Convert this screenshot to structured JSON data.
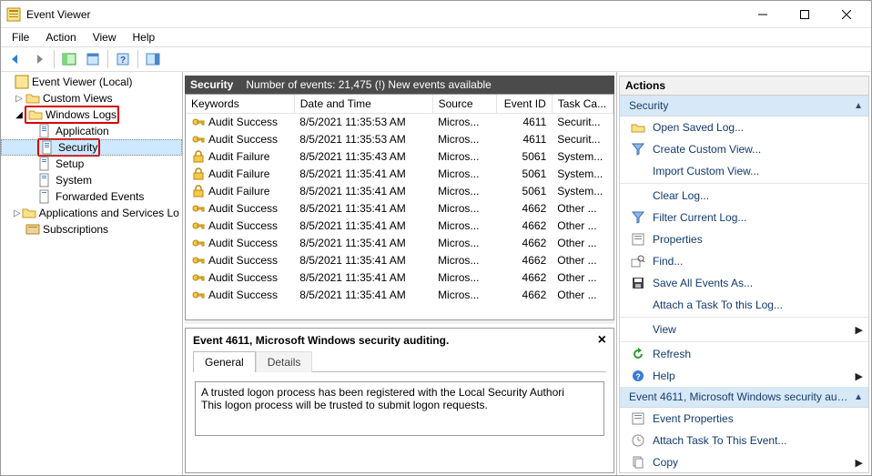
{
  "window": {
    "title": "Event Viewer"
  },
  "menu": {
    "file": "File",
    "action": "Action",
    "view": "View",
    "help": "Help"
  },
  "tree": {
    "root": "Event Viewer (Local)",
    "custom_views": "Custom Views",
    "windows_logs": "Windows Logs",
    "application": "Application",
    "security": "Security",
    "setup": "Setup",
    "system": "System",
    "forwarded": "Forwarded Events",
    "apps_services": "Applications and Services Lo",
    "subscriptions": "Subscriptions"
  },
  "gridHeader": {
    "title": "Security",
    "count_label": "Number of events: 21,475 (!) New events available"
  },
  "columns": {
    "keywords": "Keywords",
    "datetime": "Date and Time",
    "source": "Source",
    "eventid": "Event ID",
    "taskcat": "Task Ca..."
  },
  "events": [
    {
      "icon": "key",
      "keywords": "Audit Success",
      "dt": "8/5/2021 11:35:53 AM",
      "source": "Micros...",
      "id": "4611",
      "cat": "Securit..."
    },
    {
      "icon": "key",
      "keywords": "Audit Success",
      "dt": "8/5/2021 11:35:53 AM",
      "source": "Micros...",
      "id": "4611",
      "cat": "Securit..."
    },
    {
      "icon": "lock",
      "keywords": "Audit Failure",
      "dt": "8/5/2021 11:35:43 AM",
      "source": "Micros...",
      "id": "5061",
      "cat": "System..."
    },
    {
      "icon": "lock",
      "keywords": "Audit Failure",
      "dt": "8/5/2021 11:35:41 AM",
      "source": "Micros...",
      "id": "5061",
      "cat": "System..."
    },
    {
      "icon": "lock",
      "keywords": "Audit Failure",
      "dt": "8/5/2021 11:35:41 AM",
      "source": "Micros...",
      "id": "5061",
      "cat": "System..."
    },
    {
      "icon": "key",
      "keywords": "Audit Success",
      "dt": "8/5/2021 11:35:41 AM",
      "source": "Micros...",
      "id": "4662",
      "cat": "Other ..."
    },
    {
      "icon": "key",
      "keywords": "Audit Success",
      "dt": "8/5/2021 11:35:41 AM",
      "source": "Micros...",
      "id": "4662",
      "cat": "Other ..."
    },
    {
      "icon": "key",
      "keywords": "Audit Success",
      "dt": "8/5/2021 11:35:41 AM",
      "source": "Micros...",
      "id": "4662",
      "cat": "Other ..."
    },
    {
      "icon": "key",
      "keywords": "Audit Success",
      "dt": "8/5/2021 11:35:41 AM",
      "source": "Micros...",
      "id": "4662",
      "cat": "Other ..."
    },
    {
      "icon": "key",
      "keywords": "Audit Success",
      "dt": "8/5/2021 11:35:41 AM",
      "source": "Micros...",
      "id": "4662",
      "cat": "Other ..."
    },
    {
      "icon": "key",
      "keywords": "Audit Success",
      "dt": "8/5/2021 11:35:41 AM",
      "source": "Micros...",
      "id": "4662",
      "cat": "Other ..."
    }
  ],
  "detail": {
    "title": "Event 4611, Microsoft Windows security auditing.",
    "tab_general": "General",
    "tab_details": "Details",
    "body_line1": "A trusted logon process has been registered with the Local Security Authori",
    "body_line2": "This logon process will be trusted to submit logon requests."
  },
  "actions": {
    "title": "Actions",
    "sec_header": "Security",
    "open_saved": "Open Saved Log...",
    "create_view": "Create Custom View...",
    "import_view": "Import Custom View...",
    "clear_log": "Clear Log...",
    "filter_log": "Filter Current Log...",
    "properties": "Properties",
    "find": "Find...",
    "save_all": "Save All Events As...",
    "attach_task": "Attach a Task To this Log...",
    "view": "View",
    "refresh": "Refresh",
    "help": "Help",
    "evt_header": "Event 4611, Microsoft Windows security audit...",
    "evt_props": "Event Properties",
    "evt_attach": "Attach Task To This Event...",
    "evt_copy": "Copy"
  }
}
